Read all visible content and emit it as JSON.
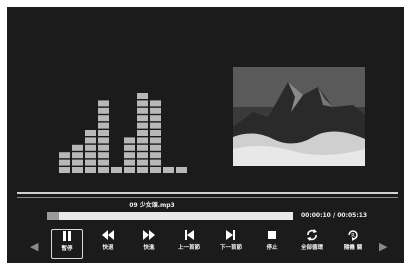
{
  "player": {
    "track_title": "09  少女頌.mp3",
    "progress_fraction": 0.05,
    "time_elapsed": "00:00:10",
    "time_separator": "/",
    "time_total": "00:05:13"
  },
  "equalizer": {
    "bar_levels": [
      2,
      3,
      5,
      9,
      0,
      4,
      10,
      9,
      0
    ],
    "colors": {
      "bar": "#b8b8b8"
    }
  },
  "controls": {
    "pause": {
      "label": "暫停",
      "icon": "pause-icon",
      "selected": true
    },
    "rewind": {
      "label": "快退",
      "icon": "rewind-icon"
    },
    "fast_forward": {
      "label": "快進",
      "icon": "fast-forward-icon"
    },
    "previous": {
      "label": "上一首節",
      "icon": "previous-icon"
    },
    "next": {
      "label": "下一首節",
      "icon": "next-icon"
    },
    "stop": {
      "label": "停止",
      "icon": "stop-icon"
    },
    "repeat_all": {
      "label": "全部循環",
      "icon": "repeat-icon"
    },
    "shuffle": {
      "label": "隨機 關",
      "icon": "shuffle-icon"
    }
  },
  "nav": {
    "left_arrow": "◀",
    "right_arrow": "▶"
  },
  "colors": {
    "background": "#1b1b1b",
    "accent": "#ffffff"
  }
}
